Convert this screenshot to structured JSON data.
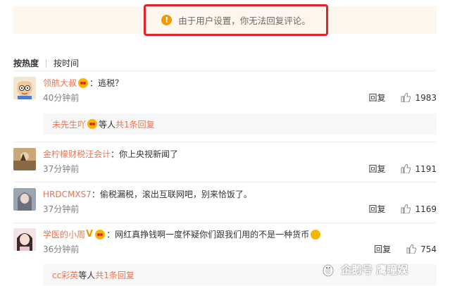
{
  "notice": {
    "icon": "warning-icon",
    "text": "由于用户设置，你无法回复评论。"
  },
  "sort": {
    "hot": "按热度",
    "time": "按时间"
  },
  "comments": [
    {
      "user": "领航大叔",
      "suffix": "：逃税？",
      "time": "40分钟前",
      "reply": "回复",
      "likes": "1983",
      "sub": {
        "user": "未先生吖",
        "mid": " 等人 ",
        "link": "共1条回复"
      }
    },
    {
      "user": "金柠檬财税汪会计",
      "suffix": "：你上央视新闻了",
      "time": "37分钟前",
      "reply": "回复",
      "likes": "1191"
    },
    {
      "user": "HRDCMXS7",
      "suffix": "：偷税漏税，滚出互联网吧，别来恰饭了。",
      "time": "37分钟前",
      "reply": "回复",
      "likes": "1169"
    },
    {
      "user": "学医的小周",
      "suffix": "：网红真挣钱啊一度怀疑你们跟我们用的不是一种货币",
      "time": "36分钟前",
      "reply": "回复",
      "likes": "754",
      "sub": {
        "user": "cc彩英",
        "mid": " 等人 ",
        "link": "共1条回复"
      }
    }
  ],
  "watermark": {
    "text": "企鹅号 鹰瞳娱"
  },
  "colors": {
    "accent": "#eb7350",
    "notice_bg": "#fdf6ec",
    "highlight_border": "#e0242f"
  }
}
